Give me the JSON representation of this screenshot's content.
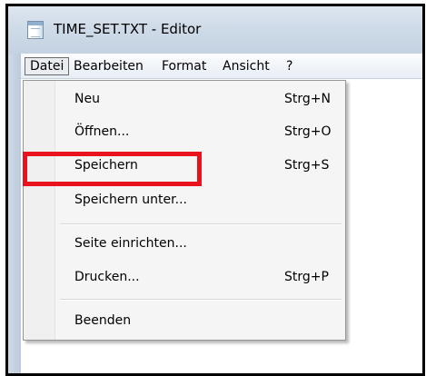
{
  "window": {
    "title": "TIME_SET.TXT - Editor",
    "icon": "notepad-icon"
  },
  "menubar": {
    "items": [
      {
        "label": "Datei",
        "active": true
      },
      {
        "label": "Bearbeiten",
        "active": false
      },
      {
        "label": "Format",
        "active": false
      },
      {
        "label": "Ansicht",
        "active": false
      },
      {
        "label": "?",
        "active": false
      }
    ]
  },
  "file_menu": {
    "items": [
      {
        "label": "Neu",
        "shortcut": "Strg+N"
      },
      {
        "label": "Öffnen...",
        "shortcut": "Strg+O"
      },
      {
        "label": "Speichern",
        "shortcut": "Strg+S"
      },
      {
        "label": "Speichern unter...",
        "shortcut": ""
      },
      {
        "label": "Seite einrichten...",
        "shortcut": ""
      },
      {
        "label": "Drucken...",
        "shortcut": "Strg+P"
      },
      {
        "label": "Beenden",
        "shortcut": ""
      }
    ]
  },
  "annotation": {
    "highlight_color": "#e8131c",
    "target": "Speichern"
  }
}
